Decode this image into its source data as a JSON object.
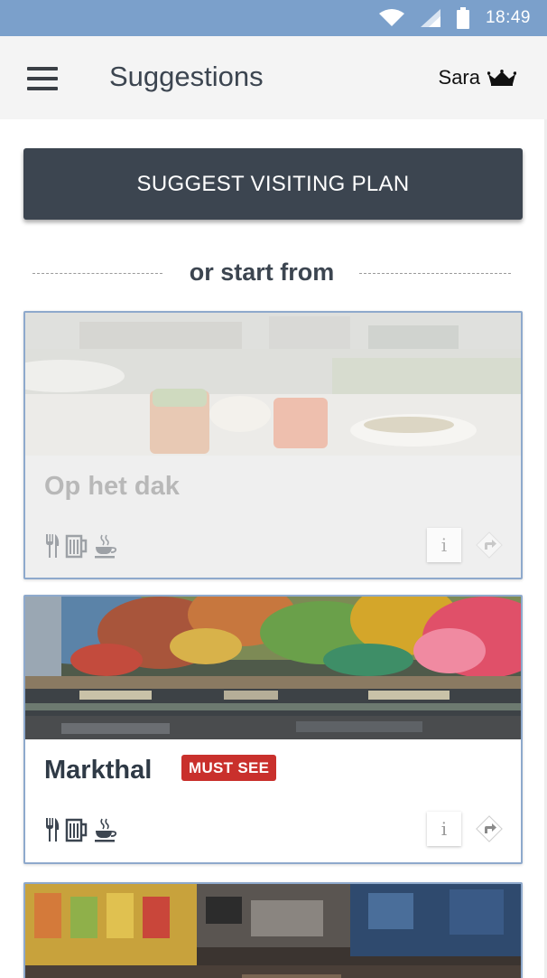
{
  "status_bar": {
    "time": "18:49",
    "icons": [
      "wifi-icon",
      "signal-icon",
      "battery-icon"
    ]
  },
  "app_bar": {
    "title": "Suggestions",
    "user_name": "Sara",
    "menu_icon": "hamburger-menu-icon",
    "crown_icon": "crown-icon"
  },
  "cta": {
    "label": "SUGGEST VISITING PLAN"
  },
  "divider": {
    "label": "or start from"
  },
  "places": [
    {
      "name": "Op het dak",
      "badge": "",
      "state": "disabled",
      "amenities": [
        "restaurant-icon",
        "bar-icon",
        "cafe-icon"
      ]
    },
    {
      "name": "Markthal",
      "badge": "MUST SEE",
      "state": "active",
      "amenities": [
        "restaurant-icon",
        "bar-icon",
        "cafe-icon"
      ]
    },
    {
      "name": "",
      "badge": "",
      "state": "active",
      "amenities": []
    }
  ],
  "card_actions": {
    "info_label": "i",
    "directions_icon": "directions-icon"
  },
  "colors": {
    "status_bar": "#7ba0cb",
    "app_bar": "#f4f4f4",
    "cta": "#3c4550",
    "badge": "#c9302c",
    "card_border": "#8ea9cc"
  }
}
